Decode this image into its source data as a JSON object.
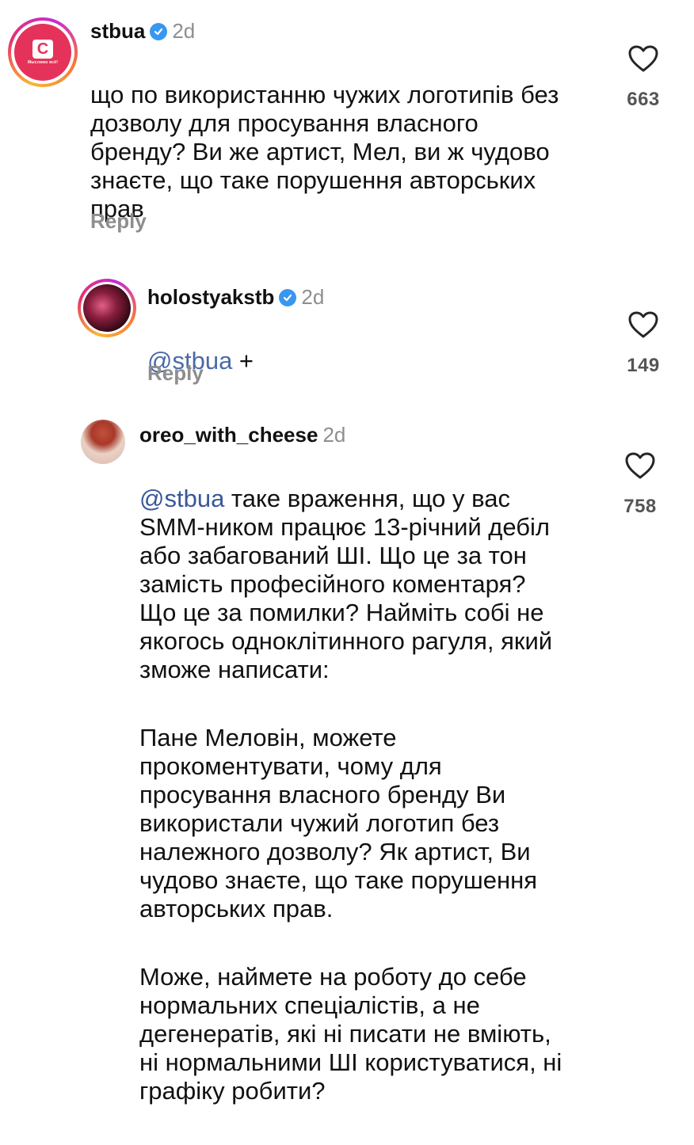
{
  "comments": [
    {
      "username": "stbua",
      "verified": true,
      "time": "2d",
      "avatar_text": "C",
      "avatar_tag": "Мыслимо всё!",
      "text": "що по використанню чужих логотипів без\nдозволу для просування власного\nбренду? Ви же артист, Мел, ви ж чудово\nзнаєте, що таке порушення авторських\nправ",
      "reply_label": "Reply",
      "likes": "663"
    },
    {
      "username": "holostyakstb",
      "verified": true,
      "time": "2d",
      "mention": "@stbua",
      "text": " +",
      "reply_label": "Reply",
      "likes": "149"
    },
    {
      "username": "oreo_with_cheese",
      "verified": false,
      "time": "2d",
      "mention": "@stbua",
      "paragraphs": [
        " таке враження, що у вас\nSMM-ником працює 13-річний дебіл\nабо забагований ШІ. Що це за тон\nзамість професійного коментаря?\nЩо це за помилки? Найміть собі не\nякогось одноклітинного рагуля, який\nзможе написати:",
        "Пане Меловін, можете\nпрокоментувати, чому для\nпросування власного бренду Ви\nвикористали чужий логотип без\nналежного дозволу? Як артист, Ви\nчудово знаєте, що таке порушення\nавторських прав.",
        "Може, наймете на роботу до себе\nнормальних спеціалістів, а не\nдегенератів, які ні писати не вміють,\nні нормальними ШІ користуватися, ні\nграфіку робити?"
      ],
      "likes": "758"
    }
  ],
  "colors": {
    "mention": "#385898",
    "verified": "#3897f0",
    "secondary_text": "#8e8e8e",
    "stb_red": "#e5325a"
  },
  "icons": [
    "verified-badge-icon",
    "heart-outline-icon"
  ]
}
